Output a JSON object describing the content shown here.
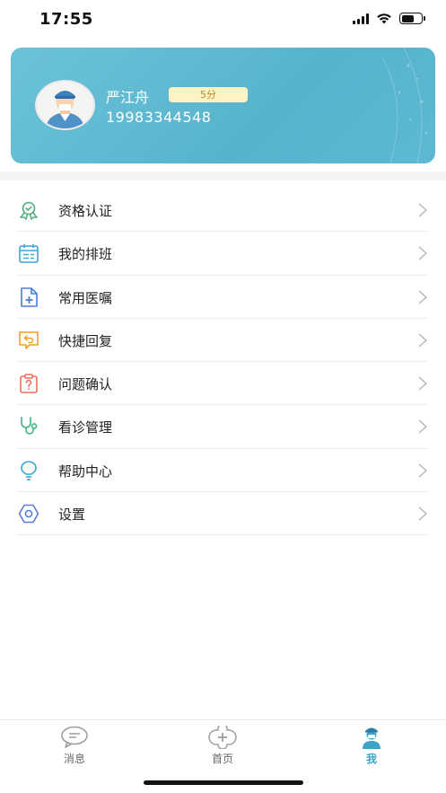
{
  "status_bar": {
    "time": "17:55",
    "battery_level": 0.65
  },
  "profile": {
    "name": "严江舟",
    "score_badge": "5分",
    "phone": "19983344548",
    "card_colors": [
      "#6cc3d8",
      "#57b3cc"
    ]
  },
  "menu": {
    "items": [
      {
        "label": "资格认证",
        "icon": "certificate-badge-icon",
        "color": "#4caf7d"
      },
      {
        "label": "我的排班",
        "icon": "calendar-icon",
        "color": "#3ea6d6"
      },
      {
        "label": "常用医嘱",
        "icon": "document-plus-icon",
        "color": "#4a7fd6"
      },
      {
        "label": "快捷回复",
        "icon": "reply-message-icon",
        "color": "#f0a01e"
      },
      {
        "label": "问题确认",
        "icon": "question-clipboard-icon",
        "color": "#e86f5a"
      },
      {
        "label": "看诊管理",
        "icon": "stethoscope-icon",
        "color": "#4cb88a"
      },
      {
        "label": "帮助中心",
        "icon": "lightbulb-icon",
        "color": "#35a8d8"
      },
      {
        "label": "设置",
        "icon": "hexagon-settings-icon",
        "color": "#5c7fd0"
      }
    ]
  },
  "tab_bar": {
    "tabs": [
      {
        "label": "消息",
        "icon": "message-bubble-icon",
        "active": false
      },
      {
        "label": "首页",
        "icon": "home-cross-icon",
        "active": false
      },
      {
        "label": "我",
        "icon": "profile-nurse-icon",
        "active": true
      }
    ],
    "active_color": "#3fa3c7"
  }
}
